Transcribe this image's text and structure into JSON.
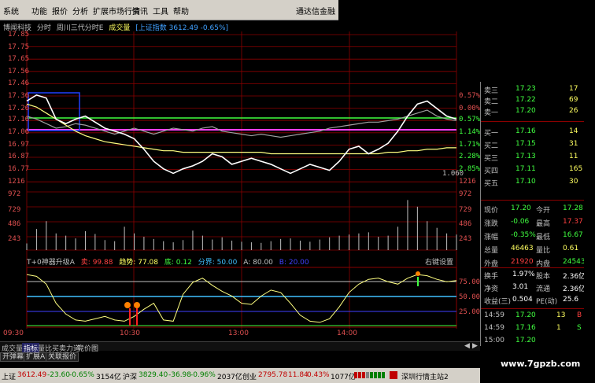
{
  "menu": {
    "items": [
      "系统",
      "功能",
      "报价",
      "分析",
      "扩展市场行情",
      "资讯",
      "工具",
      "帮助"
    ],
    "app_title": "通达信金融"
  },
  "header": {
    "stock_name": "博闻科技",
    "mode": "分时",
    "title": "周川三代分时E",
    "volume_label": "成交量",
    "index_label": "[上证指数 3612.49 -0.65%]"
  },
  "price_axis": [
    "17.85",
    "17.75",
    "17.65",
    "17.56",
    "17.46",
    "17.36",
    "17.26",
    "17.16",
    "17.06",
    "16.97",
    "16.87",
    "16.77",
    "1216"
  ],
  "pct_axis": [
    "0.57%",
    "0.00%",
    "0.57%",
    "1.14%",
    "1.71%",
    "2.28%",
    "2.85%"
  ],
  "volume_axis": [
    "1216",
    "972",
    "729",
    "486",
    "243"
  ],
  "volume_annot": "1.060",
  "chart_data": {
    "type": "line",
    "x_label": "",
    "times": [
      "09:30",
      "10:30",
      "13:00",
      "14:00"
    ],
    "ylim": [
      16.77,
      17.36
    ],
    "pre_close": 17.26,
    "series": [
      {
        "name": "price",
        "color": "#ffffff",
        "values": [
          17.3,
          17.34,
          17.32,
          17.18,
          17.15,
          17.18,
          17.2,
          17.16,
          17.12,
          17.1,
          17.08,
          17.05,
          16.98,
          16.9,
          16.85,
          16.82,
          16.85,
          16.87,
          16.9,
          16.95,
          16.93,
          16.88,
          16.9,
          16.92,
          16.9,
          16.88,
          16.85,
          16.82,
          16.85,
          16.88,
          16.86,
          16.84,
          16.9,
          16.98,
          17.0,
          16.95,
          16.98,
          17.02,
          17.1,
          17.2,
          17.28,
          17.3,
          17.25,
          17.2,
          17.18
        ]
      },
      {
        "name": "avg",
        "color": "#ffff80",
        "values": [
          17.28,
          17.26,
          17.22,
          17.18,
          17.14,
          17.1,
          17.07,
          17.05,
          17.03,
          17.02,
          17.01,
          17.0,
          16.99,
          16.98,
          16.97,
          16.97,
          16.96,
          16.96,
          16.96,
          16.96,
          16.96,
          16.96,
          16.96,
          16.96,
          16.96,
          16.95,
          16.95,
          16.95,
          16.95,
          16.95,
          16.95,
          16.95,
          16.95,
          16.95,
          16.95,
          16.95,
          16.95,
          16.96,
          16.96,
          16.97,
          16.97,
          16.98,
          16.98,
          16.99,
          16.99
        ]
      },
      {
        "name": "index",
        "color": "#a0a0a0",
        "values": [
          17.2,
          17.18,
          17.15,
          17.12,
          17.13,
          17.15,
          17.14,
          17.12,
          17.1,
          17.08,
          17.1,
          17.12,
          17.1,
          17.08,
          17.1,
          17.12,
          17.11,
          17.1,
          17.12,
          17.13,
          17.1,
          17.09,
          17.08,
          17.07,
          17.08,
          17.07,
          17.06,
          17.07,
          17.08,
          17.09,
          17.1,
          17.12,
          17.13,
          17.14,
          17.15,
          17.16,
          17.16,
          17.17,
          17.18,
          17.2,
          17.22,
          17.24,
          17.2,
          17.18,
          17.17
        ]
      }
    ],
    "volume": [
      120,
      380,
      520,
      300,
      260,
      210,
      340,
      290,
      180,
      160,
      420,
      300,
      240,
      200,
      160,
      140,
      180,
      350,
      260,
      190,
      230,
      170,
      150,
      140,
      130,
      160,
      200,
      210,
      170,
      150,
      190,
      230,
      260,
      280,
      300,
      320,
      240,
      260,
      420,
      900,
      780,
      520,
      400,
      300,
      280
    ]
  },
  "indicator": {
    "name": "T+0神器升级A",
    "sell_label": "卖: 99.88",
    "trend_label": "趋势: 77.08",
    "bottom_label": "底: 0.12",
    "divide_label": "分界: 50.00",
    "a_label": "A: 80.00",
    "b_label": "B: 20.00",
    "settings_label": "右键设置",
    "axis": [
      "75.00",
      "50.00",
      "25.00"
    ],
    "curve": [
      88,
      85,
      72,
      40,
      22,
      12,
      10,
      14,
      18,
      12,
      10,
      18,
      30,
      40,
      12,
      10,
      55,
      75,
      82,
      70,
      60,
      52,
      40,
      38,
      52,
      62,
      58,
      40,
      20,
      10,
      8,
      14,
      34,
      58,
      72,
      80,
      82,
      76,
      72,
      82,
      88,
      86,
      80,
      76,
      78
    ]
  },
  "bottom_tabs": [
    "成交量",
    "指标",
    "量比",
    "买卖力道",
    "竞价图"
  ],
  "func_tabs": [
    "开弹幕",
    "扩展A",
    "关联报价"
  ],
  "index_bar": {
    "sh_label": "上证",
    "sh_value": "3612.49",
    "sh_change": "-23.60",
    "sh_pct": "-0.65%",
    "sh_amount": "3154亿",
    "hs_label": "沪深",
    "hs_value": "3829.40",
    "hs_change": "-36.98",
    "hs_pct": "-0.96%",
    "hs_amount": "2037亿",
    "cy_label": "创业",
    "cy_value": "2795.78",
    "cy_change": "11.84",
    "cy_pct": "0.43%",
    "cy_amount": "1077亿",
    "server": "深圳行情主站2"
  },
  "quote": {
    "asks": [
      {
        "label": "卖三",
        "price": "17.23",
        "vol": "17"
      },
      {
        "label": "卖二",
        "price": "17.22",
        "vol": "69"
      },
      {
        "label": "卖一",
        "price": "17.20",
        "vol": "26"
      }
    ],
    "bids": [
      {
        "label": "买一",
        "price": "17.16",
        "vol": "14"
      },
      {
        "label": "买二",
        "price": "17.15",
        "vol": "31"
      },
      {
        "label": "买三",
        "price": "17.13",
        "vol": "11"
      },
      {
        "label": "买四",
        "price": "17.11",
        "vol": "165"
      },
      {
        "label": "买五",
        "price": "17.10",
        "vol": "30"
      }
    ],
    "stats": [
      {
        "l1": "现价",
        "v1": "17.20",
        "l2": "今开",
        "v2": "17.28"
      },
      {
        "l1": "涨跌",
        "v1": "-0.06",
        "l2": "最高",
        "v2": "17.37"
      },
      {
        "l1": "涨幅",
        "v1": "-0.35%",
        "l2": "最低",
        "v2": "16.67"
      },
      {
        "l1": "总量",
        "v1": "46463",
        "l2": "量比",
        "v2": "0.61"
      },
      {
        "l1": "外盘",
        "v1": "21920",
        "l2": "内盘",
        "v2": "24543"
      }
    ],
    "stats2": [
      {
        "l1": "换手",
        "v1": "1.97%",
        "l2": "股本",
        "v2": "2.36亿"
      },
      {
        "l1": "净资",
        "v1": "3.01",
        "l2": "流通",
        "v2": "2.36亿"
      },
      {
        "l1": "收益(三)",
        "v1": "0.504",
        "l2": "PE(动)",
        "v2": "25.6"
      }
    ],
    "ticks": [
      {
        "time": "14:59",
        "price": "17.20",
        "vol": "13",
        "side": "B"
      },
      {
        "time": "14:59",
        "price": "17.16",
        "vol": "1",
        "side": "S"
      },
      {
        "time": "15:00",
        "price": "17.20",
        "vol": "",
        "side": ""
      }
    ]
  },
  "watermark": "www.7gpzb.com",
  "colors": {
    "up": "#ff4040",
    "down": "#40ff40",
    "label": "#c0c0c0",
    "avg": "#ffff80",
    "price": "#ffffff",
    "grid": "#8b0000"
  }
}
